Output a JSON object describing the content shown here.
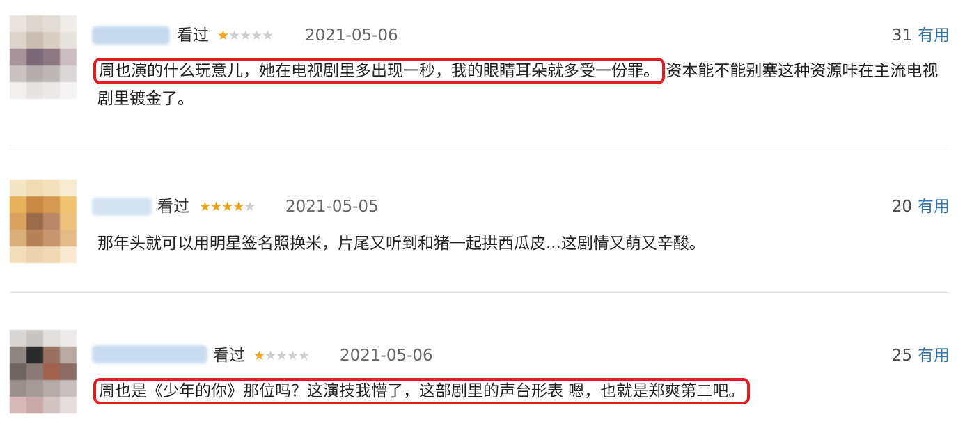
{
  "reviews": [
    {
      "status": "看过",
      "rating_stars": 1,
      "date": "2021-05-06",
      "votes": "31",
      "useful_label": "有用",
      "comment_highlight": "周也演的什么玩意儿，她在电视剧里多出现一秒，我的眼睛耳朵就多受一份罪。",
      "comment_rest": "资本能不能别塞这种资源咔在主流电视剧里镀金了。"
    },
    {
      "status": "看过",
      "rating_stars": 4,
      "date": "2021-05-05",
      "votes": "20",
      "useful_label": "有用",
      "comment_highlight": "",
      "comment_rest": "那年头就可以用明星签名照换米，片尾又听到和猪一起拱西瓜皮...这剧情又萌又辛酸。"
    },
    {
      "status": "看过",
      "rating_stars": 1,
      "date": "2021-05-06",
      "votes": "25",
      "useful_label": "有用",
      "comment_highlight": "周也是《少年的你》那位吗？这演技我懵了，这部剧里的声台形表 嗯，也就是郑爽第二吧。",
      "comment_rest": ""
    }
  ],
  "colors": {
    "star_on": "#f2a316",
    "star_off": "#cfcfcf",
    "link": "#3377aa",
    "highlight_box": "#e11b22"
  }
}
